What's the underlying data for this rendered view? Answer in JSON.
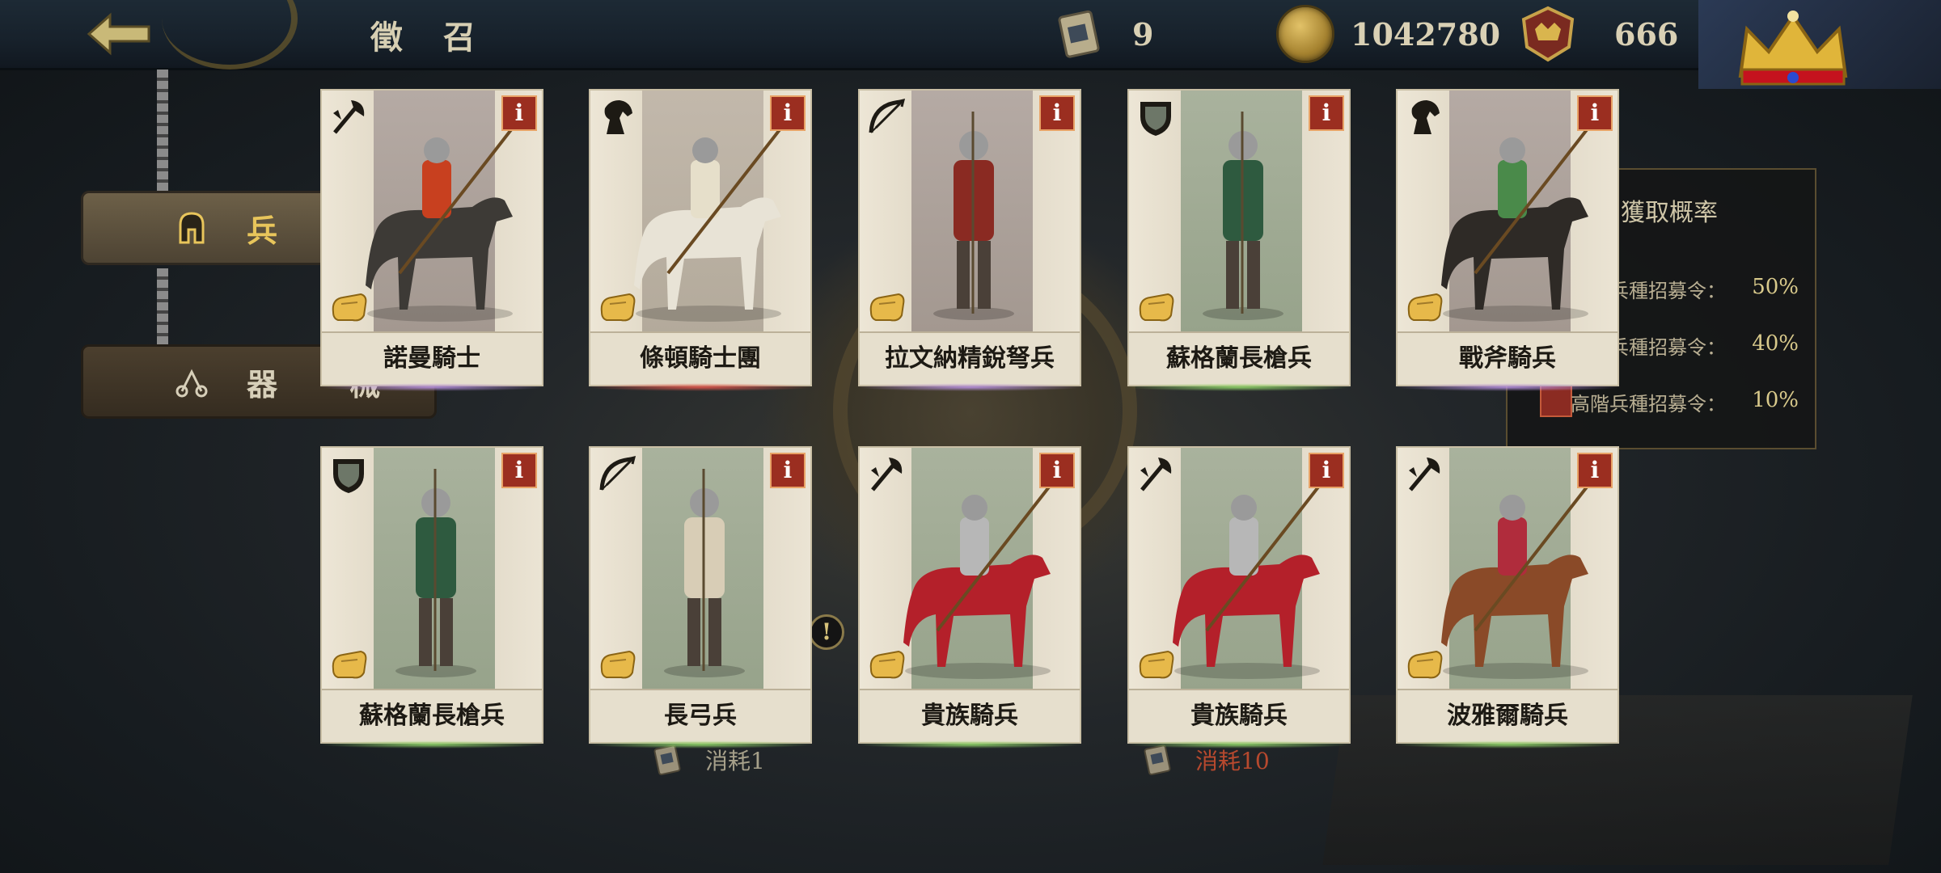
{
  "header": {
    "title": "徵 召",
    "scroll_count": "9",
    "gold": "1042780",
    "crown_points": "666"
  },
  "side_tabs": [
    {
      "label": "兵",
      "active": true
    },
    {
      "label": "器 械",
      "active": false
    }
  ],
  "rate_panel": {
    "title": "獲取概率",
    "rows": [
      {
        "label": "兵種招募令：",
        "pct": "50%"
      },
      {
        "label": "兵種招募令：",
        "pct": "40%"
      },
      {
        "label": "高階兵種招募令：",
        "pct": "10%"
      }
    ]
  },
  "cost": {
    "one": "消耗1",
    "ten": "消耗10"
  },
  "cards": [
    {
      "name": "諾曼騎士",
      "type": "axe-icon",
      "glow": "purple"
    },
    {
      "name": "條頓騎士團",
      "type": "horse-icon",
      "glow": "red"
    },
    {
      "name": "拉文納精銳弩兵",
      "type": "bow-icon",
      "glow": "purple"
    },
    {
      "name": "蘇格蘭長槍兵",
      "type": "shield-icon",
      "glow": "green"
    },
    {
      "name": "戰斧騎兵",
      "type": "horse-icon",
      "glow": "purple"
    },
    {
      "name": "蘇格蘭長槍兵",
      "type": "shield-icon",
      "glow": "green"
    },
    {
      "name": "長弓兵",
      "type": "bow-icon",
      "glow": "green"
    },
    {
      "name": "貴族騎兵",
      "type": "axe-icon",
      "glow": "green"
    },
    {
      "name": "貴族騎兵",
      "type": "axe-icon",
      "glow": "green"
    },
    {
      "name": "波雅爾騎兵",
      "type": "axe-icon",
      "glow": "green"
    }
  ],
  "colors": {
    "accent_gold": "#e8c55b",
    "info_red": "#9b2e20",
    "cost_red": "#b7492e"
  }
}
